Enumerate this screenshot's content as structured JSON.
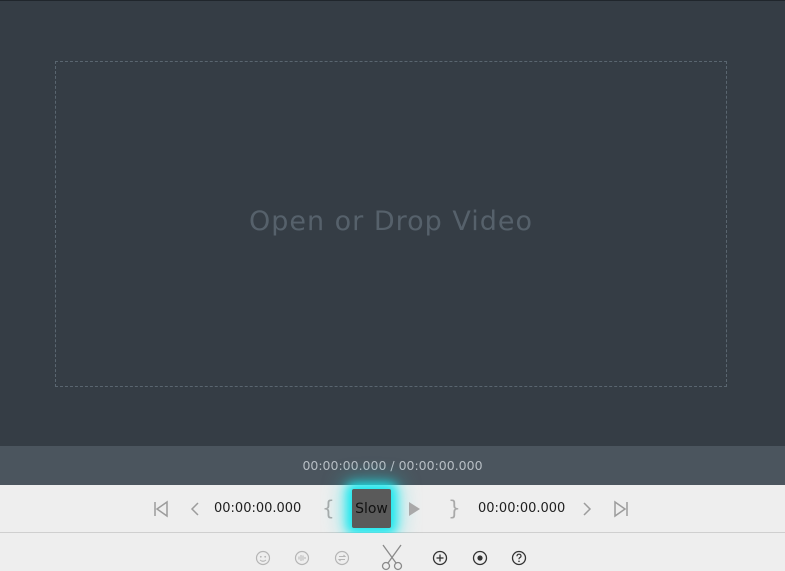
{
  "preview": {
    "drop_text": "Open or Drop Video"
  },
  "timebar": {
    "position_text": "00:00:00.000 / 00:00:00.000"
  },
  "controls": {
    "start_time": "00:00:00.000",
    "end_time": "00:00:00.000",
    "speed_label": "Slow",
    "mark_in_label": "{",
    "mark_out_label": "}"
  },
  "icons": {
    "go_start": "skip-to-start-icon",
    "step_back": "chevron-left-icon",
    "play": "play-icon",
    "step_forward": "chevron-right-icon",
    "go_end": "skip-to-end-icon",
    "face": "face-icon",
    "audio": "audio-wave-icon",
    "loop": "loop-icon",
    "cut": "scissors-icon",
    "add": "plus-circle-icon",
    "record": "record-circle-icon",
    "help": "help-circle-icon"
  },
  "colors": {
    "preview_bg": "#353d45",
    "timebar_bg": "#4b555e",
    "controls_bg": "#eeeeee",
    "highlight": "#19e8ee"
  }
}
